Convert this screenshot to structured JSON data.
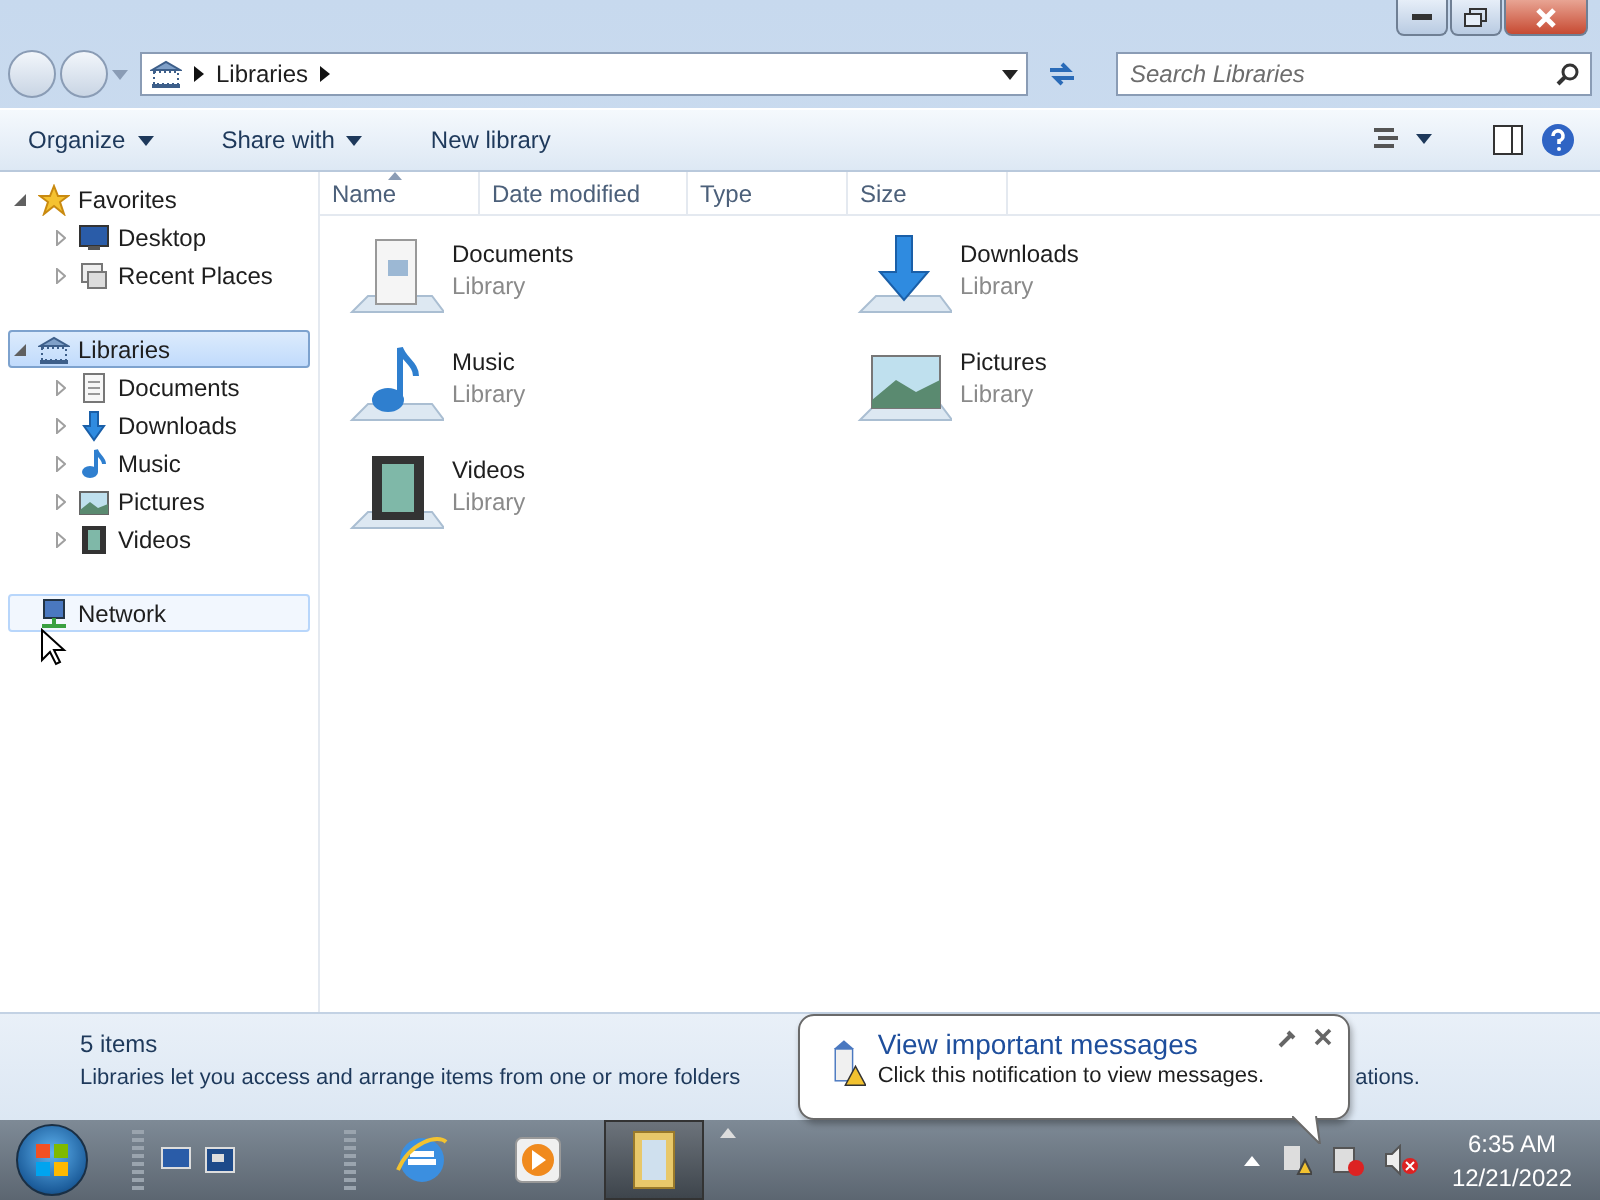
{
  "address_path": [
    "Libraries"
  ],
  "search": {
    "placeholder": "Search Libraries"
  },
  "toolbar": [
    {
      "label": "Organize",
      "dropdown": true
    },
    {
      "label": "Share with",
      "dropdown": true
    },
    {
      "label": "New library",
      "dropdown": false
    }
  ],
  "columns": [
    {
      "label": "Name",
      "sorted": true
    },
    {
      "label": "Date modified",
      "sorted": false
    },
    {
      "label": "Type",
      "sorted": false
    },
    {
      "label": "Size",
      "sorted": false
    }
  ],
  "sidebar": [
    {
      "label": "Favorites",
      "kind": "star",
      "expanded": true,
      "selected": false,
      "hovered": false,
      "children": [
        {
          "label": "Desktop",
          "kind": "desktop",
          "selected": false
        },
        {
          "label": "Recent Places",
          "kind": "recent",
          "selected": false
        }
      ]
    },
    {
      "label": "Libraries",
      "kind": "library",
      "expanded": true,
      "selected": true,
      "hovered": false,
      "children": [
        {
          "label": "Documents",
          "kind": "documents",
          "selected": false
        },
        {
          "label": "Downloads",
          "kind": "downloads",
          "selected": false
        },
        {
          "label": "Music",
          "kind": "music",
          "selected": false
        },
        {
          "label": "Pictures",
          "kind": "pictures",
          "selected": false
        },
        {
          "label": "Videos",
          "kind": "videos",
          "selected": false
        }
      ]
    },
    {
      "label": "Network",
      "kind": "network",
      "expanded": false,
      "selected": false,
      "hovered": true
    }
  ],
  "items": [
    {
      "name": "Documents",
      "type": "Library",
      "kind": "documents"
    },
    {
      "name": "Downloads",
      "type": "Library",
      "kind": "downloads"
    },
    {
      "name": "Music",
      "type": "Library",
      "kind": "music"
    },
    {
      "name": "Pictures",
      "type": "Library",
      "kind": "pictures"
    },
    {
      "name": "Videos",
      "type": "Library",
      "kind": "videos"
    }
  ],
  "status": {
    "count": "5 items",
    "description_start": "Libraries let you access and arrange items from one or more folders",
    "description_end": "ations."
  },
  "notification": {
    "title": "View important messages",
    "message": "Click this notification to view messages."
  },
  "taskbar": {
    "buttons": [
      {
        "kind": "ie",
        "selected": false
      },
      {
        "kind": "media",
        "selected": false
      },
      {
        "kind": "explorer",
        "selected": true
      }
    ],
    "clock": {
      "time": "6:35 AM",
      "date": "12/21/2022"
    }
  }
}
